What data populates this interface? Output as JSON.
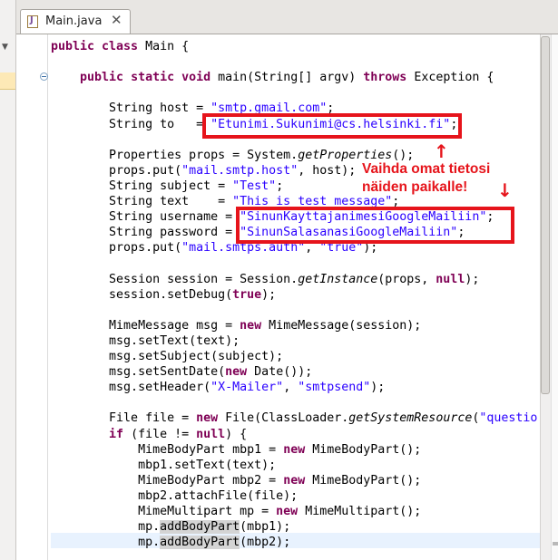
{
  "tab": {
    "label": "Main.java",
    "close_glyph": "✕"
  },
  "annotation": {
    "line1": "Vaihda omat tietosi",
    "line2": "näiden paikalle!",
    "up_arrow": "↑",
    "down_arrow": "↓"
  },
  "colors": {
    "keyword": "#7f0055",
    "string": "#2a00ff",
    "annotation": "#e6141b",
    "current_line": "#e8f2fe"
  },
  "code_lines": [
    [
      {
        "t": "public class",
        "c": "kw"
      },
      {
        "t": " Main {"
      }
    ],
    [],
    [
      {
        "t": "    "
      },
      {
        "t": "public static void",
        "c": "kw"
      },
      {
        "t": " main(String[] argv) "
      },
      {
        "t": "throws",
        "c": "kw"
      },
      {
        "t": " Exception {"
      }
    ],
    [],
    [
      {
        "t": "        String host = "
      },
      {
        "t": "\"smtp.gmail.com\"",
        "c": "str"
      },
      {
        "t": ";"
      }
    ],
    [
      {
        "t": "        String to   = "
      },
      {
        "t": "\"Etunimi.Sukunimi@cs.helsinki.fi\"",
        "c": "str"
      },
      {
        "t": ";"
      }
    ],
    [],
    [
      {
        "t": "        Properties props = System."
      },
      {
        "t": "getProperties",
        "c": "it"
      },
      {
        "t": "();"
      }
    ],
    [
      {
        "t": "        props.put("
      },
      {
        "t": "\"mail.smtp.host\"",
        "c": "str"
      },
      {
        "t": ", host);"
      }
    ],
    [
      {
        "t": "        String subject = "
      },
      {
        "t": "\"Test\"",
        "c": "str"
      },
      {
        "t": ";"
      }
    ],
    [
      {
        "t": "        String text    = "
      },
      {
        "t": "\"This is test message\"",
        "c": "str"
      },
      {
        "t": ";"
      }
    ],
    [
      {
        "t": "        String username = "
      },
      {
        "t": "\"SinunKayttajanimesiGoogleMailiin\"",
        "c": "str"
      },
      {
        "t": ";"
      }
    ],
    [
      {
        "t": "        String password = "
      },
      {
        "t": "\"SinunSalasanasiGoogleMailiin\"",
        "c": "str"
      },
      {
        "t": ";"
      }
    ],
    [
      {
        "t": "        props.put("
      },
      {
        "t": "\"mail.smtps.auth\"",
        "c": "str"
      },
      {
        "t": ", "
      },
      {
        "t": "\"true\"",
        "c": "str"
      },
      {
        "t": ");"
      }
    ],
    [],
    [
      {
        "t": "        Session session = Session."
      },
      {
        "t": "getInstance",
        "c": "it"
      },
      {
        "t": "(props, "
      },
      {
        "t": "null",
        "c": "kw"
      },
      {
        "t": ");"
      }
    ],
    [
      {
        "t": "        session.setDebug("
      },
      {
        "t": "true",
        "c": "kw"
      },
      {
        "t": ");"
      }
    ],
    [],
    [
      {
        "t": "        MimeMessage msg = "
      },
      {
        "t": "new",
        "c": "kw"
      },
      {
        "t": " MimeMessage(session);"
      }
    ],
    [
      {
        "t": "        msg.setText(text);"
      }
    ],
    [
      {
        "t": "        msg.setSubject(subject);"
      }
    ],
    [
      {
        "t": "        msg.setSentDate("
      },
      {
        "t": "new",
        "c": "kw"
      },
      {
        "t": " Date());"
      }
    ],
    [
      {
        "t": "        msg.setHeader("
      },
      {
        "t": "\"X-Mailer\"",
        "c": "str"
      },
      {
        "t": ", "
      },
      {
        "t": "\"smtpsend\"",
        "c": "str"
      },
      {
        "t": ");"
      }
    ],
    [],
    [
      {
        "t": "        File file = "
      },
      {
        "t": "new",
        "c": "kw"
      },
      {
        "t": " File(ClassLoader."
      },
      {
        "t": "getSystemResource",
        "c": "it"
      },
      {
        "t": "("
      },
      {
        "t": "\"questio",
        "c": "str"
      }
    ],
    [
      {
        "t": "        "
      },
      {
        "t": "if",
        "c": "kw"
      },
      {
        "t": " (file != "
      },
      {
        "t": "null",
        "c": "kw"
      },
      {
        "t": ") {"
      }
    ],
    [
      {
        "t": "            MimeBodyPart mbp1 = "
      },
      {
        "t": "new",
        "c": "kw"
      },
      {
        "t": " MimeBodyPart();"
      }
    ],
    [
      {
        "t": "            mbp1.setText(text);"
      }
    ],
    [
      {
        "t": "            MimeBodyPart mbp2 = "
      },
      {
        "t": "new",
        "c": "kw"
      },
      {
        "t": " MimeBodyPart();"
      }
    ],
    [
      {
        "t": "            mbp2.attachFile(file);"
      }
    ],
    [
      {
        "t": "            MimeMultipart mp = "
      },
      {
        "t": "new",
        "c": "kw"
      },
      {
        "t": " MimeMultipart();"
      }
    ],
    [
      {
        "t": "            mp."
      },
      {
        "t": "addBodyPart",
        "c": "occ"
      },
      {
        "t": "(mbp1);"
      }
    ],
    [
      {
        "t": "            mp."
      },
      {
        "t": "addBodyPart",
        "c": "occ"
      },
      {
        "t": "(mbp2);"
      }
    ]
  ]
}
